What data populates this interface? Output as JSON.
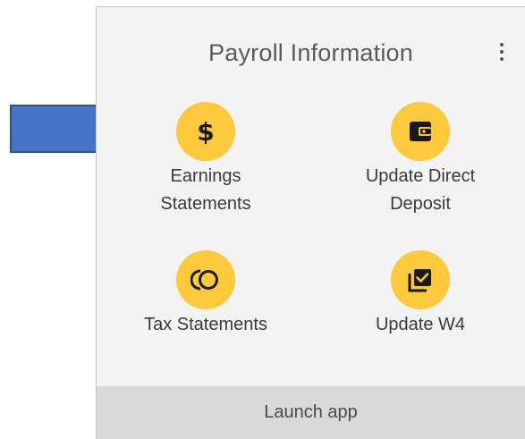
{
  "card": {
    "title": "Payroll Information",
    "menu_icon": "more-vertical-icon"
  },
  "tiles": [
    {
      "label_line1": "Earnings",
      "label_line2": "Statements",
      "icon": "dollar-icon",
      "glyph": "$"
    },
    {
      "label_line1": "Update Direct",
      "label_line2": "Deposit",
      "icon": "wallet-icon"
    },
    {
      "label_line1": "Tax Statements",
      "icon": "coins-icon"
    },
    {
      "label_line1": "Update W4",
      "icon": "library-add-check-icon"
    }
  ],
  "footer": {
    "launch_label": "Launch app"
  },
  "annotation": {
    "icon": "arrow-right-icon",
    "color": "#4472c4"
  },
  "colors": {
    "icon_circle": "#fbc93a",
    "card_bg": "#f3f3f3",
    "footer_bg": "#d9d9d9"
  }
}
